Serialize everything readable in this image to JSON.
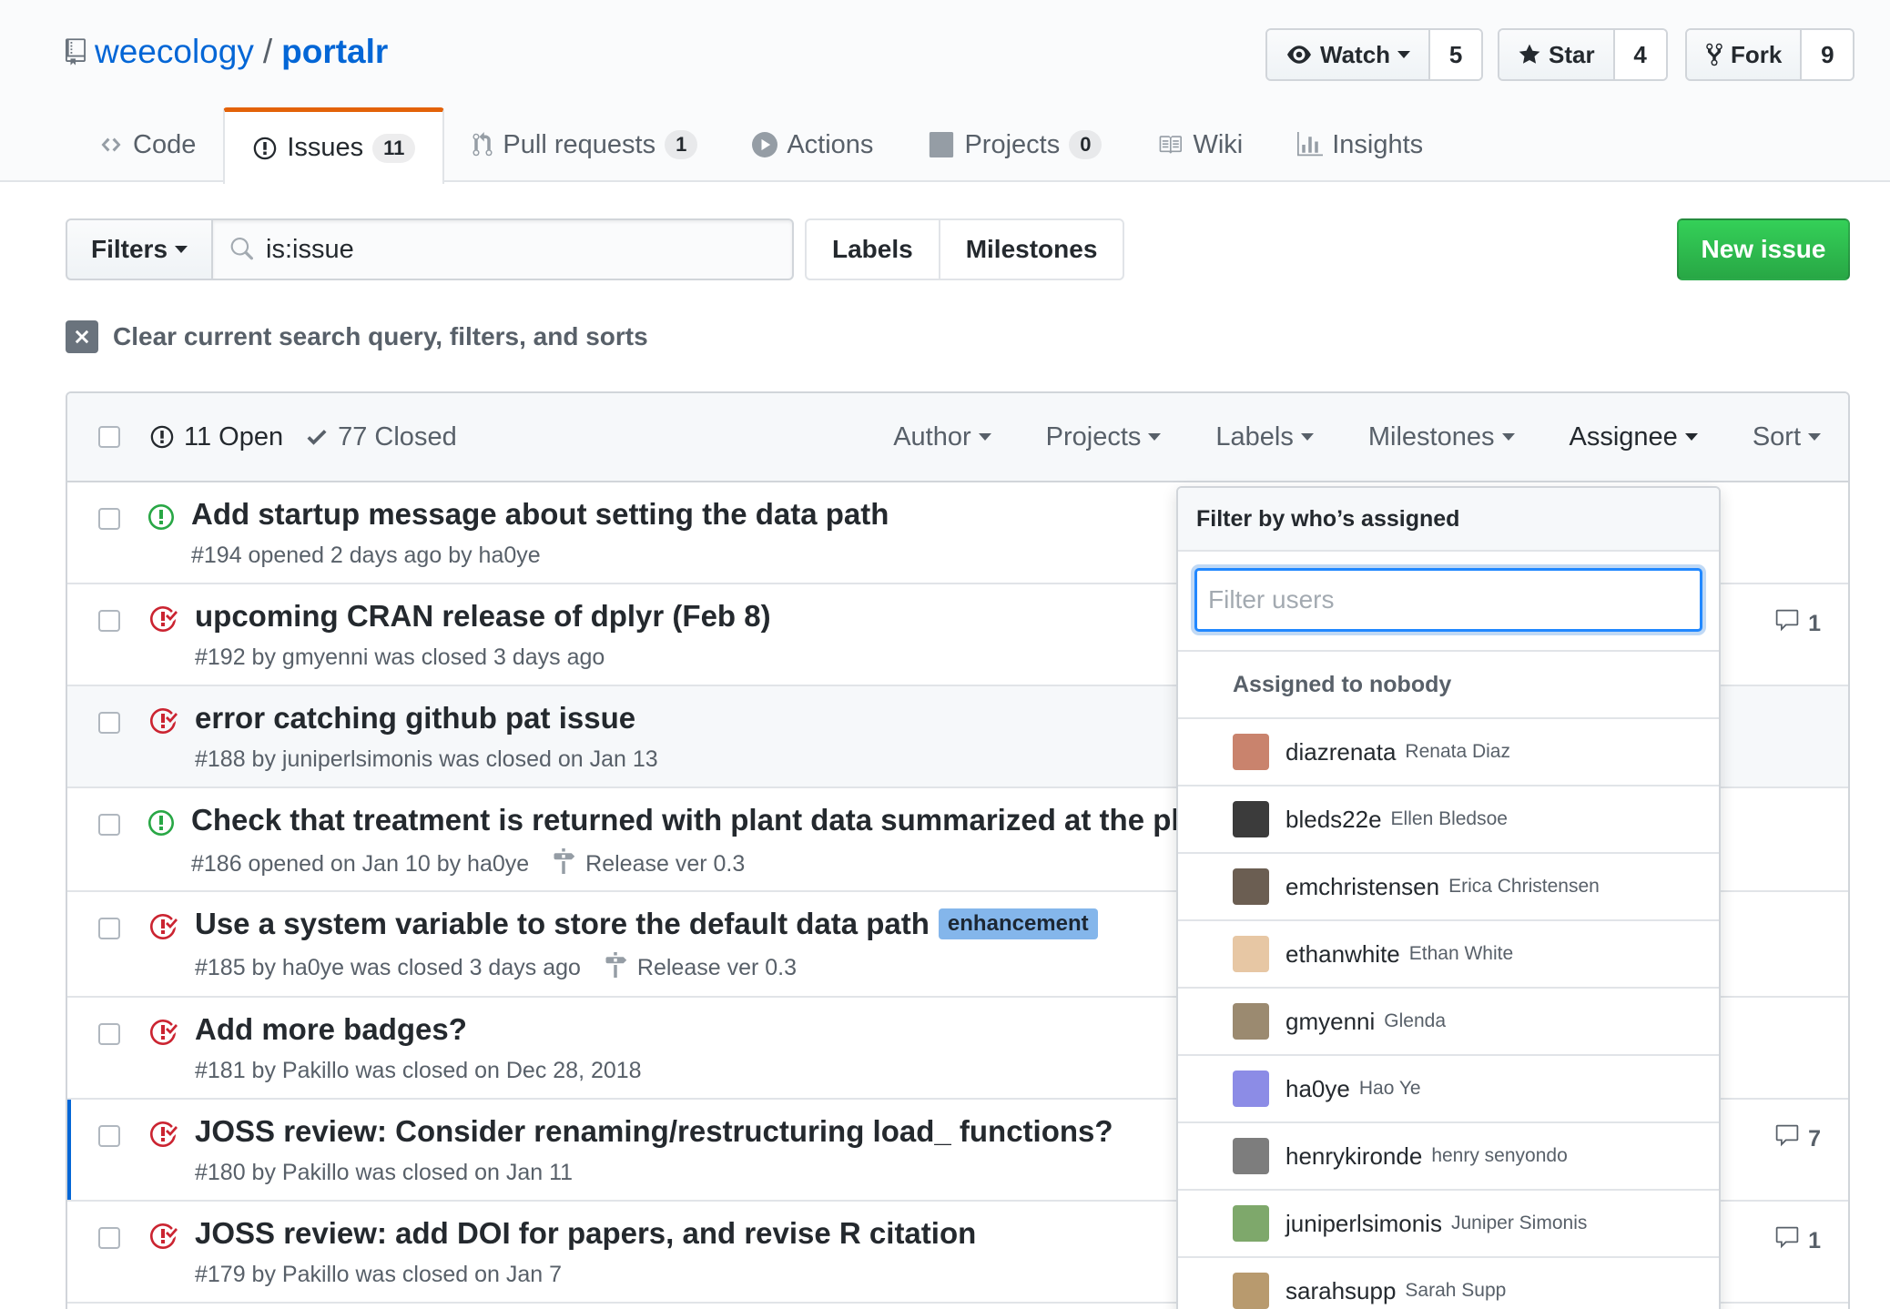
{
  "repo": {
    "owner": "weecology",
    "separator": "/",
    "name": "portalr"
  },
  "social": {
    "watch": {
      "label": "Watch",
      "count": "5"
    },
    "star": {
      "label": "Star",
      "count": "4"
    },
    "fork": {
      "label": "Fork",
      "count": "9"
    }
  },
  "tabs": [
    {
      "label": "Code",
      "counter": null
    },
    {
      "label": "Issues",
      "counter": "11"
    },
    {
      "label": "Pull requests",
      "counter": "1"
    },
    {
      "label": "Actions",
      "counter": null
    },
    {
      "label": "Projects",
      "counter": "0"
    },
    {
      "label": "Wiki",
      "counter": null
    },
    {
      "label": "Insights",
      "counter": null
    }
  ],
  "toolbar": {
    "filters_label": "Filters",
    "search_value": "is:issue",
    "labels_label": "Labels",
    "milestones_label": "Milestones",
    "new_issue_label": "New issue"
  },
  "clear_query_label": "Clear current search query, filters, and sorts",
  "list_header": {
    "open_label": "11 Open",
    "closed_label": "77 Closed",
    "filters": [
      "Author",
      "Projects",
      "Labels",
      "Milestones",
      "Assignee",
      "Sort"
    ]
  },
  "issues": [
    {
      "state": "open",
      "title": "Add startup message about setting the data path",
      "meta": "#194 opened 2 days ago by ha0ye",
      "milestone": "",
      "label": "",
      "comments": ""
    },
    {
      "state": "closed",
      "title": "upcoming CRAN release of dplyr (Feb 8)",
      "meta": "#192 by gmyenni was closed 3 days ago",
      "milestone": "",
      "label": "",
      "comments": "1"
    },
    {
      "state": "closed",
      "title": "error catching github pat issue",
      "meta": "#188 by juniperlsimonis was closed on Jan 13",
      "milestone": "",
      "label": "",
      "comments": ""
    },
    {
      "state": "open",
      "title": "Check that treatment is returned with plant data summarized at the plot",
      "meta": "#186 opened on Jan 10 by ha0ye",
      "milestone": "Release ver 0.3",
      "label": "",
      "comments": ""
    },
    {
      "state": "closed",
      "title": "Use a system variable to store the default data path",
      "meta": "#185 by ha0ye was closed 3 days ago",
      "milestone": "Release ver 0.3",
      "label": "enhancement",
      "comments": ""
    },
    {
      "state": "closed",
      "title": "Add more badges?",
      "meta": "#181 by Pakillo was closed on Dec 28, 2018",
      "milestone": "",
      "label": "",
      "comments": ""
    },
    {
      "state": "closed",
      "title": "JOSS review: Consider renaming/restructuring load_ functions?",
      "meta": "#180 by Pakillo was closed on Jan 11",
      "milestone": "",
      "label": "",
      "comments": "7"
    },
    {
      "state": "closed",
      "title": "JOSS review: add DOI for papers, and revise R citation",
      "meta": "#179 by Pakillo was closed on Jan 7",
      "milestone": "",
      "label": "",
      "comments": "1"
    }
  ],
  "assignee_dropdown": {
    "header": "Filter by who’s assigned",
    "filter_placeholder": "Filter users",
    "nobody_label": "Assigned to nobody",
    "users": [
      {
        "login": "diazrenata",
        "name": "Renata Diaz",
        "avatar_color": "#c9836d"
      },
      {
        "login": "bleds22e",
        "name": "Ellen Bledsoe",
        "avatar_color": "#3b3b3b"
      },
      {
        "login": "emchristensen",
        "name": "Erica Christensen",
        "avatar_color": "#6b5e52"
      },
      {
        "login": "ethanwhite",
        "name": "Ethan White",
        "avatar_color": "#e7c7a4"
      },
      {
        "login": "gmyenni",
        "name": "Glenda",
        "avatar_color": "#9b8a70"
      },
      {
        "login": "ha0ye",
        "name": "Hao Ye",
        "avatar_color": "#8c8ce6"
      },
      {
        "login": "henrykironde",
        "name": "henry senyondo",
        "avatar_color": "#7d7d7d"
      },
      {
        "login": "juniperlsimonis",
        "name": "Juniper Simonis",
        "avatar_color": "#7ea86b"
      },
      {
        "login": "sarahsupp",
        "name": "Sarah Supp",
        "avatar_color": "#b89a6e"
      }
    ]
  },
  "colors": {
    "link": "#0366d6",
    "open_state": "#28a745",
    "closed_state": "#cb2431",
    "selected_tab_accent": "#e36209",
    "new_issue_button": "#28a745",
    "enhancement_label": "#84b6eb"
  },
  "icons": {
    "repo": "repo-icon",
    "watch": "eye-icon",
    "star": "star-icon",
    "fork": "fork-icon",
    "code": "code-icon",
    "issues": "issue-opened-icon",
    "pull_requests": "git-pull-request-icon",
    "actions": "play-icon",
    "projects": "project-icon",
    "wiki": "book-icon",
    "insights": "graph-icon",
    "search": "search-icon",
    "clear": "x-icon",
    "open_issue": "issue-opened-icon",
    "closed_issue": "issue-closed-icon",
    "closed_count": "check-icon",
    "milestone": "milestone-icon",
    "comment": "comment-icon"
  }
}
